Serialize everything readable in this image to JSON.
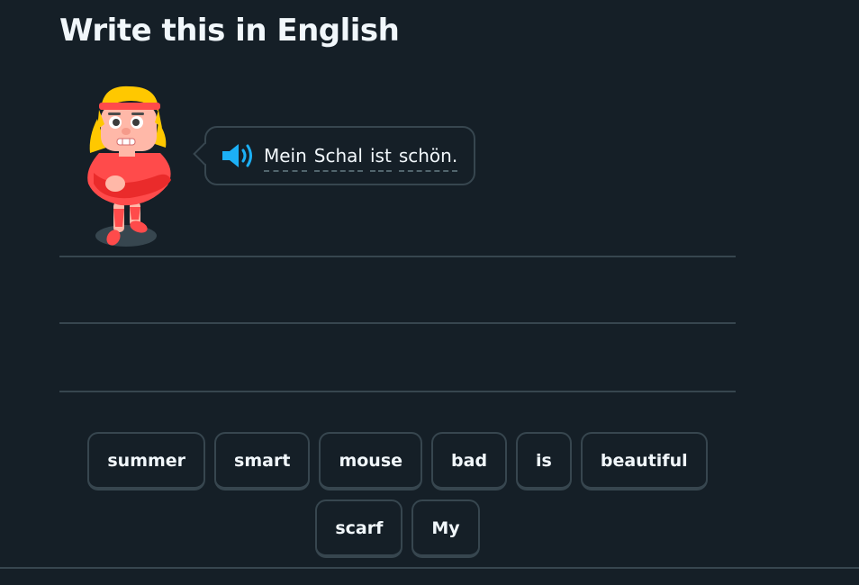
{
  "challenge": {
    "title": "Write this in English"
  },
  "prompt": {
    "words": [
      "Mein",
      "Schal",
      "ist",
      "schön."
    ],
    "speaker_icon": "speaker-icon"
  },
  "word_bank": {
    "row1": [
      "summer",
      "smart",
      "mouse",
      "bad",
      "is",
      "beautiful"
    ],
    "row2": [
      "scarf",
      "My"
    ]
  },
  "colors": {
    "background": "#151f27",
    "border": "#37464f",
    "text": "#f1f7fb",
    "speaker": "#1cb0f6",
    "character_shirt": "#ff4b4b",
    "character_hair": "#ffc800"
  }
}
